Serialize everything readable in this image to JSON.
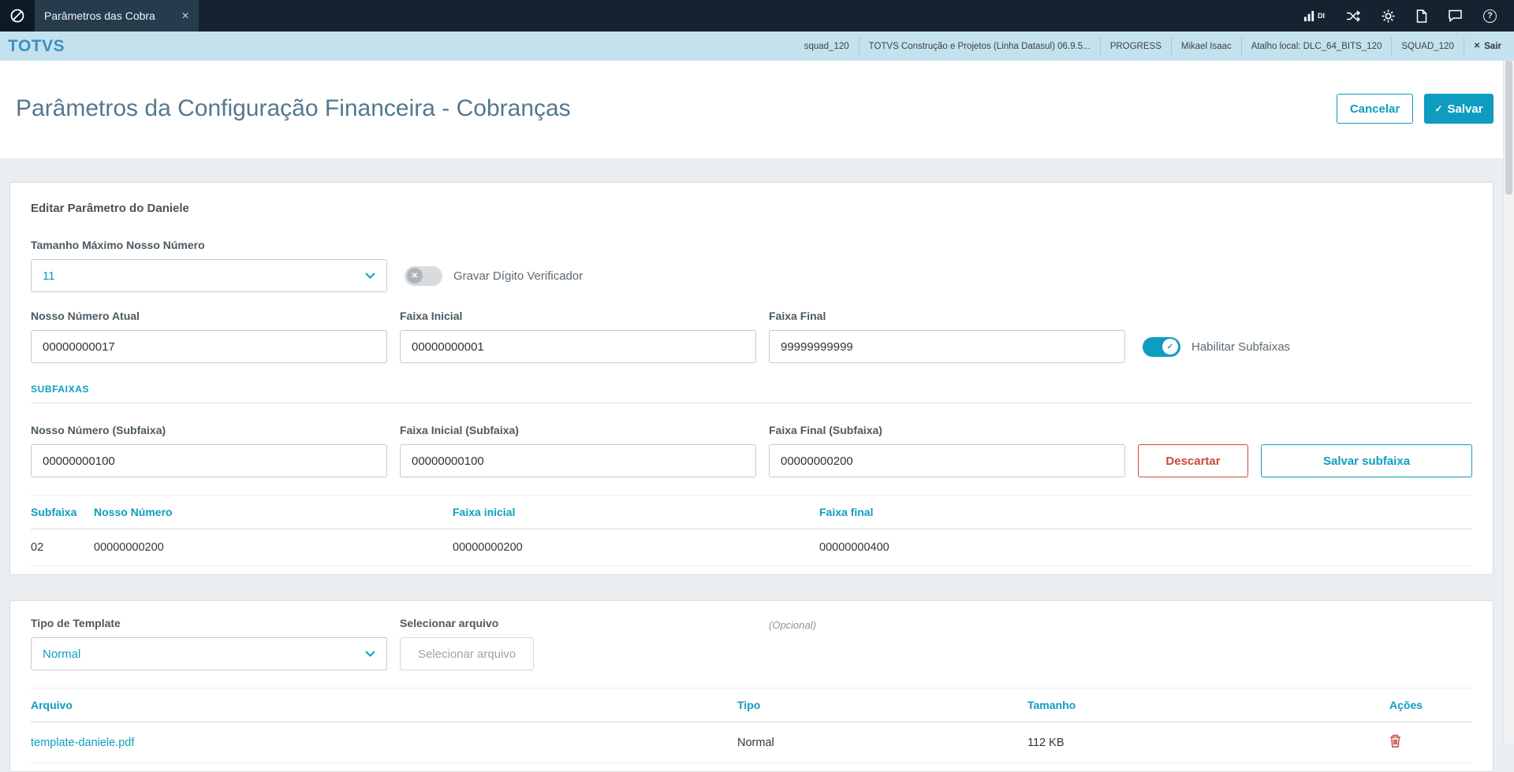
{
  "icons": {
    "close": "✕",
    "check": "✓",
    "cross": "✕",
    "question": "?"
  },
  "topbar": {
    "tab_title": "Parâmetros das Cobra",
    "di_label": "DI"
  },
  "appbar": {
    "brand": "TOTVS",
    "env_items": [
      "squad_120",
      "TOTVS Construção e Projetos (Linha Datasul) 06.9.5...",
      "PROGRESS",
      "Mikael Isaac",
      "Atalho local: DLC_64_BITS_120",
      "SQUAD_120"
    ],
    "logout_label": "Sair"
  },
  "page": {
    "title": "Parâmetros da Configuração Financeira - Cobranças",
    "cancel_label": "Cancelar",
    "save_label": "Salvar"
  },
  "parametros": {
    "heading": "Editar Parâmetro do Daniele",
    "tamanho_maximo": {
      "label": "Tamanho Máximo Nosso Número",
      "value": "11"
    },
    "gravar_digito_label": "Gravar Dígito Verificador",
    "nosso_numero_atual": {
      "label": "Nosso Número Atual",
      "value": "00000000017"
    },
    "faixa_inicial": {
      "label": "Faixa Inicial",
      "value": "00000000001"
    },
    "faixa_final": {
      "label": "Faixa Final",
      "value": "99999999999"
    },
    "habilitar_subfaixas_label": "Habilitar Subfaixas",
    "subfaixas_section_label": "SUBFAIXAS",
    "nosso_numero_subfaixa": {
      "label": "Nosso Número (Subfaixa)",
      "value": "00000000100"
    },
    "faixa_inicial_subfaixa": {
      "label": "Faixa Inicial (Subfaixa)",
      "value": "00000000100"
    },
    "faixa_final_subfaixa": {
      "label": "Faixa Final (Subfaixa)",
      "value": "00000000200"
    },
    "descartar_label": "Descartar",
    "salvar_subfaixa_label": "Salvar subfaixa",
    "subfaixas_table": {
      "headers": [
        "Subfaixa",
        "Nosso Número",
        "Faixa inicial",
        "Faixa final"
      ],
      "rows": [
        {
          "subfaixa": "02",
          "nosso_numero": "00000000200",
          "faixa_inicial": "00000000200",
          "faixa_final": "00000000400"
        }
      ]
    }
  },
  "template": {
    "tipo": {
      "label": "Tipo de Template",
      "value": "Normal"
    },
    "arquivo": {
      "label": "Selecionar arquivo",
      "button_label": "Selecionar arquivo",
      "optional_label": "(Opcional)"
    },
    "arquivos_table": {
      "headers": [
        "Arquivo",
        "Tipo",
        "Tamanho",
        "Ações"
      ],
      "rows": [
        {
          "arquivo": "template-daniele.pdf",
          "tipo": "Normal",
          "tamanho": "112 KB"
        }
      ]
    }
  },
  "colors": {
    "primary": "#0e9dc0",
    "danger": "#cf4536",
    "topbar_bg": "#14232f",
    "appbar_bg": "#c4e1ee"
  }
}
